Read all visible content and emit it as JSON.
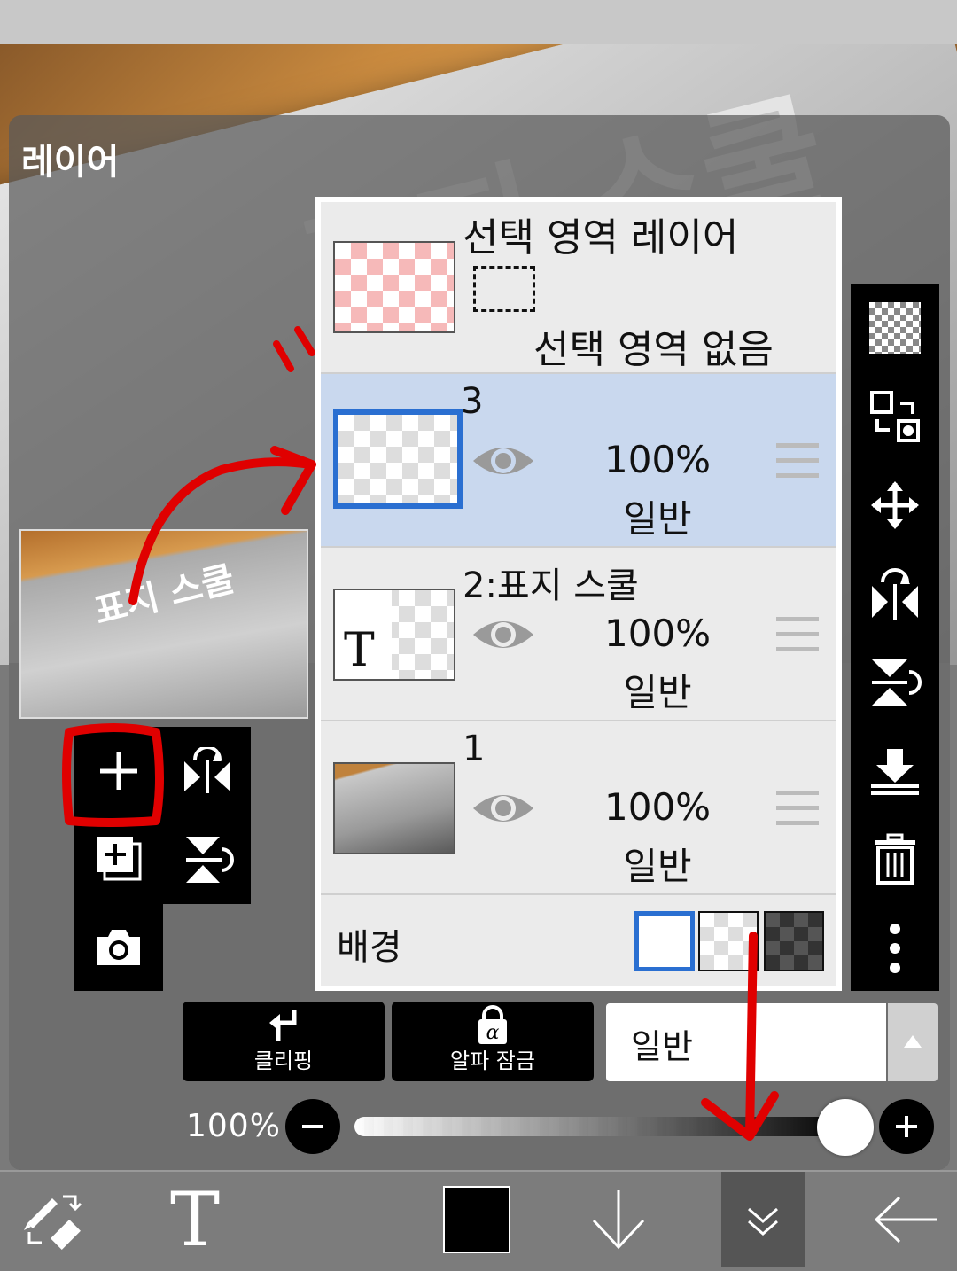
{
  "canvas": {
    "paper_title": "표지 스쿨"
  },
  "panel": {
    "title": "레이어"
  },
  "preview": {
    "label": "표지 스쿨"
  },
  "layers": {
    "selection_layer": {
      "title": "선택 영역 레이어",
      "status": "선택 영역 없음"
    },
    "rows": [
      {
        "name": "3",
        "opacity": "100%",
        "mode": "일반",
        "selected": true
      },
      {
        "name": "2:표지 스쿨",
        "opacity": "100%",
        "mode": "일반",
        "thumb_letter": "T",
        "selected": false
      },
      {
        "name": "1",
        "opacity": "100%",
        "mode": "일반",
        "selected": false
      }
    ],
    "background_label": "배경"
  },
  "controls": {
    "clipping_label": "클리핑",
    "alpha_lock_label": "알파 잠금",
    "blend_mode": "일반",
    "opacity_value": "100%"
  },
  "bottombar": {
    "text_tool_glyph": "T"
  },
  "colors": {
    "selected_row": "#c9d8ee",
    "accent_blue": "#2a6fd1",
    "annotation_red": "#e00000"
  }
}
